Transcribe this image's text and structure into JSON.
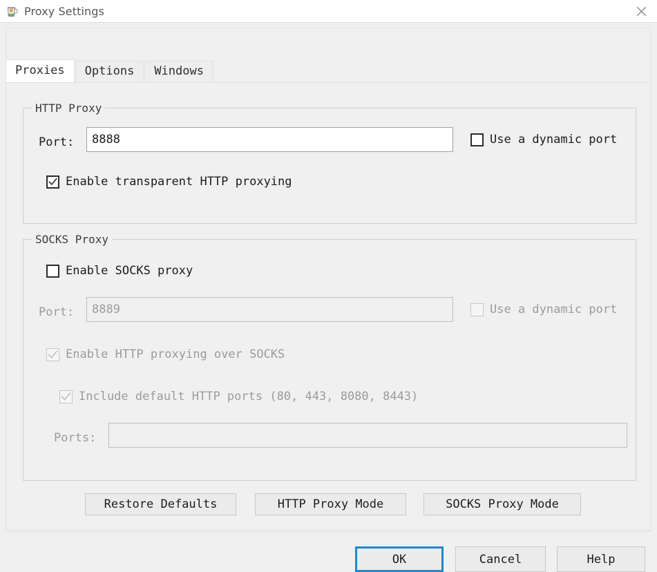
{
  "window": {
    "title": "Proxy Settings",
    "icon": "burp-jug-icon",
    "close_icon": "close-icon"
  },
  "tabs": [
    {
      "label": "Proxies",
      "selected": true
    },
    {
      "label": "Options",
      "selected": false
    },
    {
      "label": "Windows",
      "selected": false
    }
  ],
  "http_proxy": {
    "group_title": "HTTP Proxy",
    "port_label": "Port:",
    "port_value": "8888",
    "port_placeholder": "",
    "dynamic_port": {
      "label": "Use a dynamic port",
      "checked": false,
      "enabled": true
    },
    "transparent": {
      "label": "Enable transparent HTTP proxying",
      "checked": true,
      "enabled": true
    }
  },
  "socks_proxy": {
    "group_title": "SOCKS Proxy",
    "enable": {
      "label": "Enable SOCKS proxy",
      "checked": false,
      "enabled": true
    },
    "port_label": "Port:",
    "port_value": "8889",
    "port_enabled": false,
    "dynamic_port": {
      "label": "Use a dynamic port",
      "checked": false,
      "enabled": false
    },
    "http_over_socks": {
      "label": "Enable HTTP proxying over SOCKS",
      "checked": true,
      "enabled": false
    },
    "include_default_ports": {
      "label": "Include default HTTP ports (80, 443, 8080, 8443)",
      "checked": true,
      "enabled": false
    },
    "ports_label": "Ports:",
    "ports_value": "",
    "ports_enabled": false
  },
  "mode_buttons": [
    {
      "label": "Restore Defaults"
    },
    {
      "label": "HTTP Proxy Mode"
    },
    {
      "label": "SOCKS Proxy Mode"
    }
  ],
  "dialog_buttons": [
    {
      "label": "OK",
      "focused": true
    },
    {
      "label": "Cancel",
      "focused": false
    },
    {
      "label": "Help",
      "focused": false
    }
  ],
  "colors": {
    "focus_blue": "#1e88d2",
    "dialog_bg": "#f0f0f0",
    "panel_border": "#cfcfcf",
    "disabled_text": "#9b9b9b",
    "title_text": "#585858"
  }
}
